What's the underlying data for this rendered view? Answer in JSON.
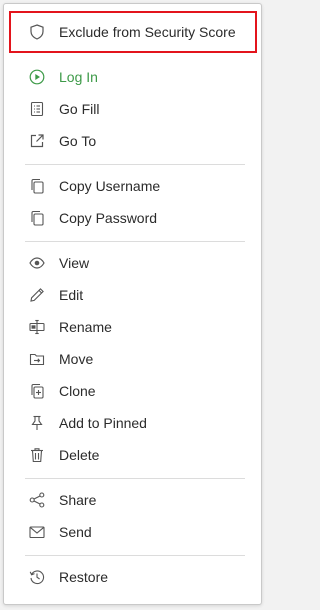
{
  "menu": {
    "items": [
      {
        "label": "Exclude from Security Score",
        "icon": "shield-icon",
        "color": "#2b2b2b"
      },
      {
        "label": "Log In",
        "icon": "play-circle-icon",
        "color": "#3d9a48"
      },
      {
        "label": "Go Fill",
        "icon": "form-list-icon",
        "color": "#2b2b2b"
      },
      {
        "label": "Go To",
        "icon": "external-link-icon",
        "color": "#2b2b2b"
      },
      {
        "label": "Copy Username",
        "icon": "copy-icon",
        "color": "#2b2b2b"
      },
      {
        "label": "Copy Password",
        "icon": "copy-icon",
        "color": "#2b2b2b"
      },
      {
        "label": "View",
        "icon": "eye-icon",
        "color": "#2b2b2b"
      },
      {
        "label": "Edit",
        "icon": "pencil-icon",
        "color": "#2b2b2b"
      },
      {
        "label": "Rename",
        "icon": "rename-icon",
        "color": "#2b2b2b"
      },
      {
        "label": "Move",
        "icon": "move-folder-icon",
        "color": "#2b2b2b"
      },
      {
        "label": "Clone",
        "icon": "clone-icon",
        "color": "#2b2b2b"
      },
      {
        "label": "Add to Pinned",
        "icon": "pin-icon",
        "color": "#2b2b2b"
      },
      {
        "label": "Delete",
        "icon": "trash-icon",
        "color": "#2b2b2b"
      },
      {
        "label": "Share",
        "icon": "share-icon",
        "color": "#2b2b2b"
      },
      {
        "label": "Send",
        "icon": "envelope-icon",
        "color": "#2b2b2b"
      },
      {
        "label": "Restore",
        "icon": "history-icon",
        "color": "#2b2b2b"
      }
    ],
    "highlight_color": "#e3141c",
    "accent_color": "#3d9a48"
  }
}
